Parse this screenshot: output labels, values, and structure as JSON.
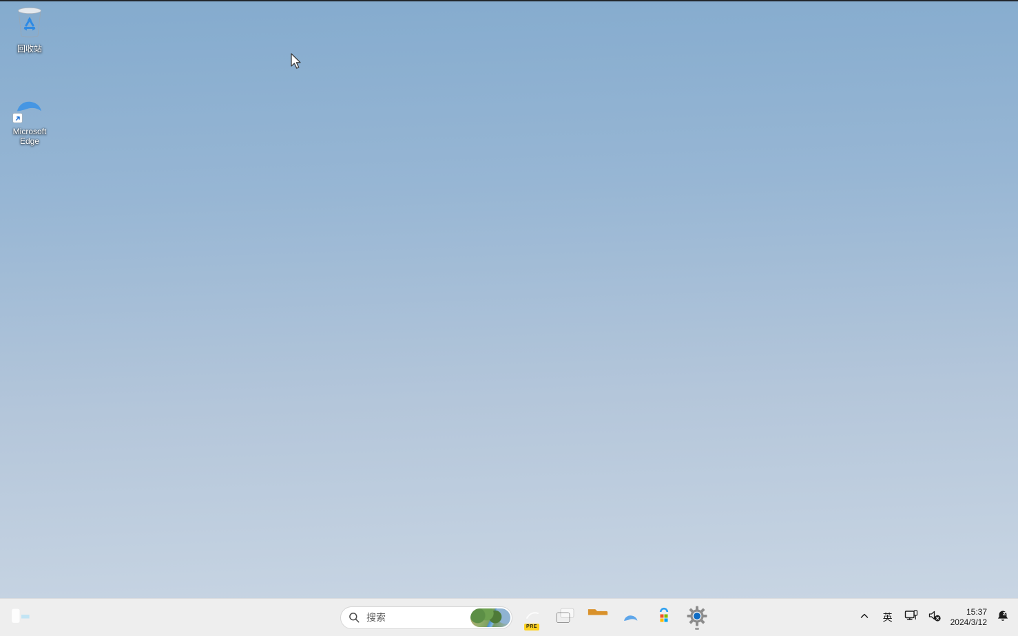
{
  "window": {
    "title": "Windows 11 Desktop (zh-CN)"
  },
  "desktop": {
    "icons": [
      {
        "id": "recycle-bin",
        "label": "回收站"
      },
      {
        "id": "microsoft-edge",
        "label": "Microsoft Edge"
      }
    ],
    "cursor": {
      "state": "busy",
      "description": "arrow pointer with blue busy ring at upper-left area"
    }
  },
  "taskbar": {
    "search": {
      "placeholder": "搜索"
    },
    "apps": [
      {
        "name": "copilot-preview",
        "badge": "PRE"
      },
      {
        "name": "task-view"
      },
      {
        "name": "file-explorer"
      },
      {
        "name": "microsoft-edge"
      },
      {
        "name": "microsoft-store"
      },
      {
        "name": "settings",
        "running": true
      }
    ],
    "tray": {
      "ime_label": "英",
      "clock": {
        "time": "15:37",
        "date": "2024/3/12"
      }
    }
  },
  "icons": {
    "widgets-icon": "blue rounded panel, white left half and sky-blue right half",
    "windows-start-icon": "four blue squares",
    "search-icon": "magnifier",
    "bing-thumbnail": "small landscape photo at right end of search box",
    "copilot-icon": "multicolor ribbon logo with yellow PRE badge",
    "task-view-icon": "two overlapping windows, light back and dark front",
    "folder-icon": "yellow folder with blue tray",
    "edge-icon": "blue and green swirl",
    "store-icon": "blue shopping bag with four colored tiles",
    "gear-icon": "gray gear with blue center",
    "chevron-up-icon": "show hidden icons",
    "ethernet-icon": "monitor with network plug",
    "volume-muted-icon": "hollow speaker with dark x badge",
    "bell-dnd-icon": "dark bell with z (do not disturb)",
    "recycle-bin-icon": "gray bin with blue recycle arrows",
    "shortcut-arrow-icon": "white square with blue up-right arrow",
    "busy-ring-icon": "blue circular working-in-background ring"
  },
  "colors": {
    "taskbar_bg": "#eeeeee",
    "accent_blue": "#0f66cf",
    "wallpaper_top": "#84abce",
    "wallpaper_bottom": "#cdd9e5",
    "bloom_dark": "#0a3fa6",
    "bloom_light": "#5aa8f7"
  }
}
